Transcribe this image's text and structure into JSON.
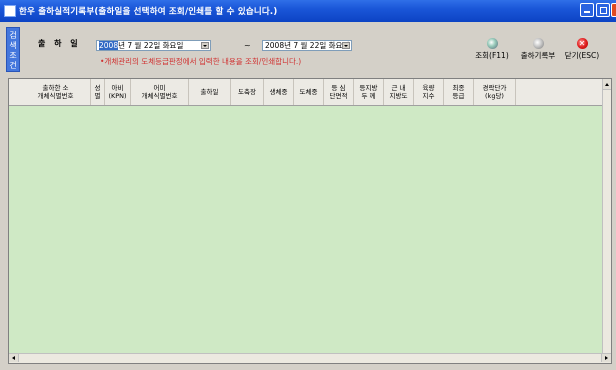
{
  "window": {
    "title": "한우 출하실적기록부(출하일을 선택하여 조회/인쇄를 할 수 있습니다.)"
  },
  "sidebar": {
    "label": "검색조건"
  },
  "filter": {
    "ship_date_label": "출 하 일",
    "date_from_year": "2008",
    "date_from_rest": "년  7 월 22일 화요일",
    "separator": "~",
    "date_to": "2008년  7 월 22일 화요일",
    "note": "•개체관리의 도체등급판정에서 입력한 내용을 조회/인쇄합니다.)"
  },
  "toolbar": {
    "search_label": "조회(F11)",
    "shipment_record_label": "출하기록부",
    "close_label": "닫기(ESC)",
    "close_glyph": "✕"
  },
  "table": {
    "columns": [
      "출하한 소\n개체식별번호",
      "성\n별",
      "아비\n(KPN)",
      "어미\n개체식별번호",
      "출하일",
      "도축장",
      "생체중",
      "도체중",
      "등 심\n단면적",
      "등지방\n두 께",
      "근 내\n지방도",
      "육량\n지수",
      "최종\n등급",
      "경락단가\n(kg당)"
    ],
    "rows": []
  },
  "colors": {
    "grid_background": "#cfe9c5",
    "titlebar": "#1a56d8",
    "note_text": "#d03030"
  }
}
